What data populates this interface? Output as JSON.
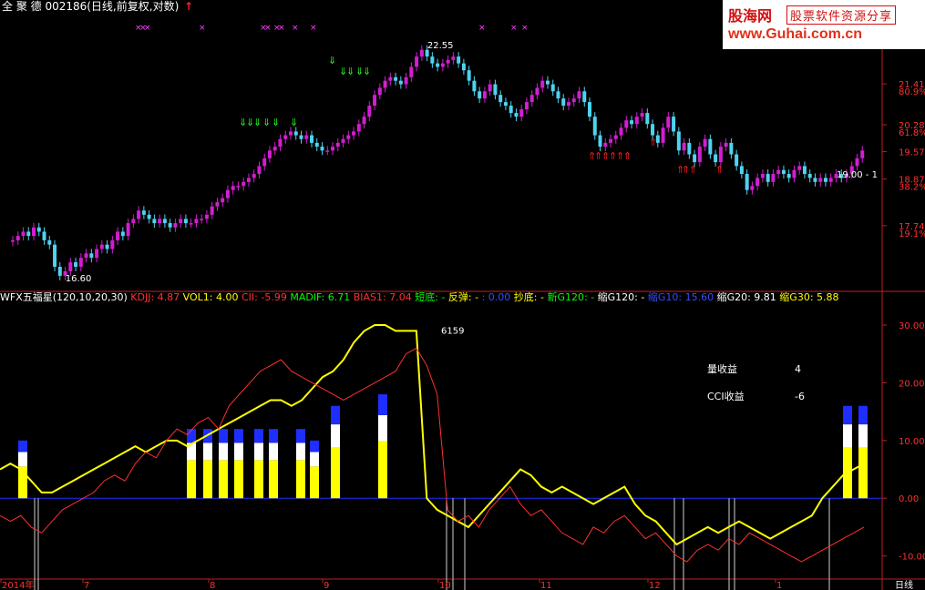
{
  "header": {
    "title": "全 聚 德 002186(日线,前复权,对数)",
    "title_color": "#ffffff",
    "arrow_glyph": "↑"
  },
  "banner": {
    "name": "股海网",
    "slogan": "股票软件资源分享",
    "url": "www.Guhai.com.cn"
  },
  "price_axis": {
    "labels": [
      "21.41",
      "80.9%",
      "20.28",
      "61.8%",
      "19.57",
      "18.87",
      "38.2%",
      "17.74",
      "19.1%"
    ],
    "marker": "19.00 - 1"
  },
  "indicator_header": {
    "items": [
      {
        "text": "WFX五福星(120,10,20,30)",
        "color": "#ffffff"
      },
      {
        "text": "KDJJ: 4.87",
        "color": "#ff3030"
      },
      {
        "text": "VOL1: 4.00",
        "color": "#ffff00"
      },
      {
        "text": "CII: -5.99",
        "color": "#ff3030"
      },
      {
        "text": "MADIF: 6.71",
        "color": "#00ff00"
      },
      {
        "text": "BIAS1: 7.04",
        "color": "#ff3030"
      },
      {
        "text": "短底: -",
        "color": "#00ff00"
      },
      {
        "text": "反弹: -",
        "color": "#ffff00"
      },
      {
        "text": ": 0.00",
        "color": "#3050ff"
      },
      {
        "text": "抄底: -",
        "color": "#ffff00"
      },
      {
        "text": "新G120: -",
        "color": "#00ff00"
      },
      {
        "text": "缩G120: -",
        "color": "#ffffff"
      },
      {
        "text": "缩G10: 15.60",
        "color": "#3050ff"
      },
      {
        "text": "缩G20: 9.81",
        "color": "#ffffff"
      },
      {
        "text": "缩G30: 5.88",
        "color": "#ffff00"
      }
    ]
  },
  "info": {
    "volume_profit_label": "量收益",
    "volume_profit_value": "4",
    "cci_profit_label": "CCI收益",
    "cci_profit_value": "-6"
  },
  "chart_data": [
    {
      "type": "candlestick",
      "title": "全 聚 德 002186(日线,前复权,对数)",
      "scale": "log",
      "ylim": [
        16.3,
        23.5
      ],
      "y_ticks": [
        21.41,
        20.28,
        19.57,
        18.87,
        17.74
      ],
      "fib_labels": [
        {
          "price": 21.41,
          "label": "80.9%"
        },
        {
          "price": 20.28,
          "label": "61.8%"
        },
        {
          "price": 18.87,
          "label": "38.2%"
        },
        {
          "price": 17.74,
          "label": "19.1%"
        }
      ],
      "annotations": [
        {
          "text": "22.55",
          "price": 22.55
        },
        {
          "text": "16.60",
          "price": 16.6
        },
        {
          "text": "19.00 - 1",
          "price": 19.0
        }
      ],
      "candles_close_approx": [
        17.4,
        17.5,
        17.6,
        17.5,
        17.7,
        17.6,
        17.4,
        17.3,
        16.8,
        16.6,
        16.7,
        16.9,
        16.8,
        17.0,
        17.1,
        17.0,
        17.2,
        17.3,
        17.2,
        17.4,
        17.6,
        17.5,
        17.8,
        17.9,
        18.1,
        18.0,
        17.9,
        17.8,
        17.9,
        17.8,
        17.7,
        17.8,
        17.9,
        17.8,
        17.8,
        17.9,
        17.9,
        18.0,
        18.2,
        18.3,
        18.4,
        18.6,
        18.7,
        18.7,
        18.8,
        18.9,
        19.0,
        19.2,
        19.4,
        19.6,
        19.7,
        19.9,
        20.0,
        20.1,
        20.0,
        19.9,
        20.0,
        19.8,
        19.7,
        19.6,
        19.6,
        19.7,
        19.8,
        19.9,
        20.0,
        20.1,
        20.3,
        20.5,
        20.8,
        21.1,
        21.3,
        21.5,
        21.6,
        21.5,
        21.4,
        21.6,
        21.9,
        22.2,
        22.4,
        22.2,
        22.0,
        21.9,
        22.0,
        22.1,
        22.2,
        22.0,
        21.8,
        21.5,
        21.2,
        21.0,
        21.2,
        21.4,
        21.1,
        20.9,
        20.8,
        20.6,
        20.5,
        20.7,
        20.9,
        21.1,
        21.3,
        21.5,
        21.4,
        21.2,
        21.0,
        20.8,
        20.9,
        21.0,
        21.2,
        20.9,
        20.5,
        20.0,
        19.7,
        19.8,
        19.9,
        20.0,
        20.2,
        20.4,
        20.3,
        20.5,
        20.6,
        20.3,
        20.0,
        19.8,
        20.2,
        20.5,
        20.1,
        19.6,
        19.8,
        19.5,
        19.3,
        19.7,
        19.9,
        19.5,
        19.3,
        19.7,
        19.8,
        19.5,
        19.2,
        19.0,
        18.6,
        18.7,
        18.9,
        19.0,
        18.8,
        19.0,
        19.1,
        19.0,
        18.9,
        19.1,
        19.2,
        19.0,
        18.9,
        18.8,
        18.9,
        18.8,
        18.9,
        19.0,
        18.9,
        19.0,
        19.2,
        19.4,
        19.6
      ],
      "x_labels": [
        "2014年",
        "7",
        "8",
        "9",
        "10",
        "11",
        "12",
        "1"
      ],
      "x_label_extra": "日线"
    },
    {
      "type": "line",
      "title": "WFX五福星(120,10,20,30)",
      "ylim": [
        -14,
        33
      ],
      "y_ticks": [
        30.0,
        20.0,
        10.0,
        0.0,
        -10.0
      ],
      "annotations": [
        {
          "text": "6159"
        }
      ],
      "series": [
        {
          "name": "VOL1",
          "color": "#ffff00",
          "values": [
            5,
            6,
            5,
            3,
            1,
            1,
            2,
            3,
            4,
            5,
            6,
            7,
            8,
            9,
            8,
            9,
            10,
            10,
            9,
            10,
            11,
            12,
            13,
            14,
            15,
            16,
            17,
            17,
            16,
            17,
            19,
            21,
            22,
            24,
            27,
            29,
            30,
            30,
            29,
            29,
            29,
            0,
            -2,
            -3,
            -4,
            -5,
            -3,
            -1,
            1,
            3,
            5,
            4,
            2,
            1,
            2,
            1,
            0,
            -1,
            0,
            1,
            2,
            -1,
            -3,
            -4,
            -6,
            -8,
            -7,
            -6,
            -5,
            -6,
            -5,
            -4,
            -5,
            -6,
            -7,
            -6,
            -5,
            -4,
            -3,
            0,
            2,
            4,
            5,
            6
          ]
        },
        {
          "name": "CII",
          "color": "#ff3030",
          "values": [
            -3,
            -4,
            -3,
            -5,
            -6,
            -4,
            -2,
            -1,
            0,
            1,
            3,
            4,
            3,
            6,
            8,
            7,
            10,
            12,
            11,
            13,
            14,
            12,
            16,
            18,
            20,
            22,
            23,
            24,
            22,
            21,
            20,
            19,
            18,
            17,
            18,
            19,
            20,
            21,
            22,
            25,
            26,
            23,
            18,
            -2,
            -4,
            -3,
            -5,
            -2,
            0,
            2,
            -1,
            -3,
            -2,
            -4,
            -6,
            -7,
            -8,
            -5,
            -6,
            -4,
            -3,
            -5,
            -7,
            -6,
            -8,
            -10,
            -11,
            -9,
            -8,
            -9,
            -7,
            -8,
            -6,
            -7,
            -8,
            -9,
            -10,
            -11,
            -10,
            -9,
            -8,
            -7,
            -6,
            -5
          ]
        }
      ]
    }
  ]
}
